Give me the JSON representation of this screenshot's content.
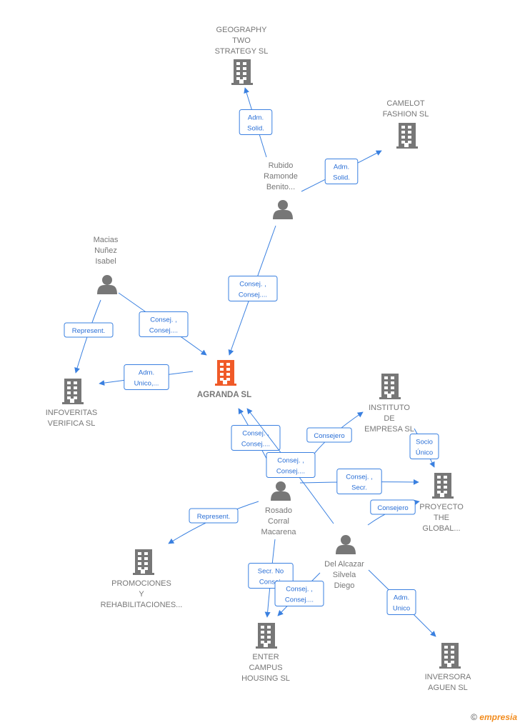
{
  "colors": {
    "accent": "#3a80e0",
    "node": "#777777",
    "main_node": "#f05a28"
  },
  "nodes": [
    {
      "id": "geography",
      "type": "company",
      "lines": [
        "GEOGRAPHY",
        "TWO",
        "STRATEGY  SL"
      ]
    },
    {
      "id": "camelot",
      "type": "company",
      "lines": [
        "CAMELOT",
        "FASHION  SL"
      ]
    },
    {
      "id": "rubido",
      "type": "person",
      "lines": [
        "Rubido",
        "Ramonde",
        "Benito..."
      ]
    },
    {
      "id": "macias",
      "type": "person",
      "lines": [
        "Macias",
        "Nuñez",
        "Isabel"
      ]
    },
    {
      "id": "agranda",
      "type": "company",
      "main": true,
      "lines": [
        "AGRANDA  SL"
      ]
    },
    {
      "id": "infoveritas",
      "type": "company",
      "lines": [
        "INFOVERITAS",
        "VERIFICA  SL"
      ]
    },
    {
      "id": "instituto",
      "type": "company",
      "lines": [
        "INSTITUTO",
        "DE",
        "EMPRESA SL"
      ]
    },
    {
      "id": "proyecto",
      "type": "company",
      "lines": [
        "PROYECTO",
        "THE",
        "GLOBAL..."
      ]
    },
    {
      "id": "rosado",
      "type": "person",
      "lines": [
        "Rosado",
        "Corral",
        "Macarena"
      ]
    },
    {
      "id": "delalcazar",
      "type": "person",
      "lines": [
        "Del Alcazar",
        "Silvela",
        "Diego"
      ]
    },
    {
      "id": "promociones",
      "type": "company",
      "lines": [
        "PROMOCIONES",
        "Y",
        "REHABILITACIONES..."
      ]
    },
    {
      "id": "enter",
      "type": "company",
      "lines": [
        "ENTER",
        "CAMPUS",
        "HOUSING  SL"
      ]
    },
    {
      "id": "inversora",
      "type": "company",
      "lines": [
        "INVERSORA",
        "AGUEN  SL"
      ]
    }
  ],
  "edges": [
    {
      "from": "rubido",
      "to": "geography",
      "label": [
        "Adm.",
        "Solid."
      ]
    },
    {
      "from": "rubido",
      "to": "camelot",
      "label": [
        "Adm.",
        "Solid."
      ]
    },
    {
      "from": "rubido",
      "to": "agranda",
      "label": [
        "Consej. ,",
        "Consej...."
      ]
    },
    {
      "from": "macias",
      "to": "agranda",
      "label": [
        "Consej. ,",
        "Consej...."
      ]
    },
    {
      "from": "macias",
      "to": "infoveritas",
      "label": [
        "Represent."
      ]
    },
    {
      "from": "agranda",
      "to": "infoveritas",
      "label": [
        "Adm.",
        "Unico,..."
      ]
    },
    {
      "from": "rosado",
      "to": "agranda",
      "label": [
        "Consej. ,",
        "Consej...."
      ]
    },
    {
      "from": "delalcazar",
      "to": "agranda",
      "label": [
        "Consej. ,",
        "Consej...."
      ]
    },
    {
      "from": "rosado",
      "to": "instituto",
      "label": [
        "Consejero"
      ]
    },
    {
      "from": "rosado",
      "to": "proyecto",
      "label": [
        "Consej. ,",
        "Secr."
      ]
    },
    {
      "from": "instituto",
      "to": "proyecto",
      "label": [
        "Socio",
        "Único"
      ]
    },
    {
      "from": "delalcazar",
      "to": "proyecto",
      "label": [
        "Consejero"
      ]
    },
    {
      "from": "rosado",
      "to": "promociones",
      "label": [
        "Represent."
      ]
    },
    {
      "from": "rosado",
      "to": "enter",
      "label": [
        "Secr.  No",
        "Consej."
      ]
    },
    {
      "from": "delalcazar",
      "to": "enter",
      "label": [
        "Consej. ,",
        "Consej...."
      ]
    },
    {
      "from": "delalcazar",
      "to": "inversora",
      "label": [
        "Adm.",
        "Unico"
      ]
    }
  ],
  "footer": {
    "copyright": "©",
    "brand": "empresia"
  }
}
